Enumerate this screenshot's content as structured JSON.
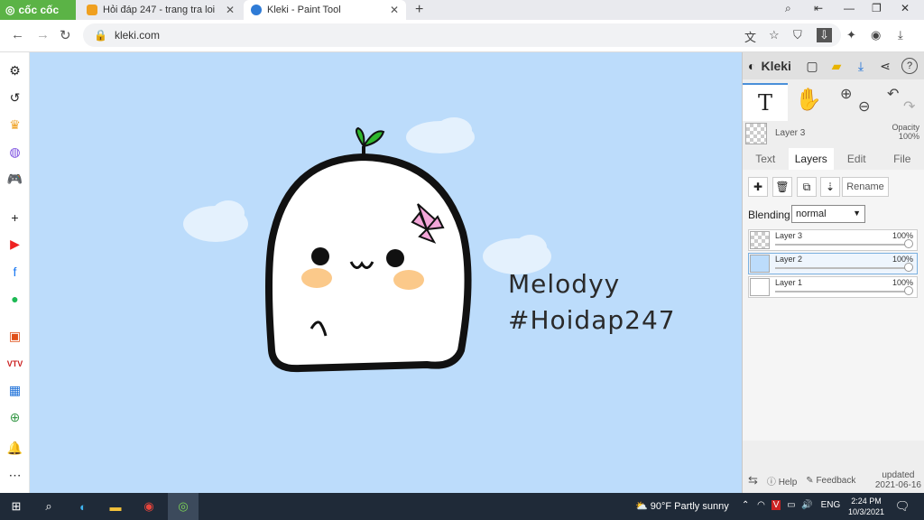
{
  "browser": {
    "brand": "cốc cốc",
    "tabs": [
      {
        "title": "Hỏi đáp 247 - trang tra loi",
        "favicon": "hoidap-favicon",
        "color": "#f0a020"
      },
      {
        "title": "Kleki - Paint Tool",
        "favicon": "kleki-favicon",
        "color": "#2f7bd6",
        "active": true
      }
    ],
    "url": "kleki.com"
  },
  "canvas": {
    "background": "#bcdcfb",
    "watermark_line1": "Melodyy",
    "watermark_line2": "#Hoidap247"
  },
  "panel": {
    "title": "Kleki",
    "current_layer": "Layer 3",
    "opacity_label": "Opacity",
    "opacity_value": "100%",
    "tabs": [
      "Text",
      "Layers",
      "Edit",
      "File"
    ],
    "active_tab": "Layers",
    "rename_label": "Rename",
    "blending_label": "Blending",
    "blending_value": "normal",
    "layers": [
      {
        "name": "Layer 3",
        "opacity": "100%",
        "selected": false
      },
      {
        "name": "Layer 2",
        "opacity": "100%",
        "selected": true
      },
      {
        "name": "Layer 1",
        "opacity": "100%",
        "selected": false
      }
    ],
    "footer": {
      "help": "Help",
      "feedback": "Feedback",
      "updated_label": "updated",
      "updated_date": "2021-06-16"
    }
  },
  "taskbar": {
    "weather": "90°F  Partly sunny",
    "lang": "ENG",
    "time": "2:24 PM",
    "date": "10/3/2021"
  }
}
